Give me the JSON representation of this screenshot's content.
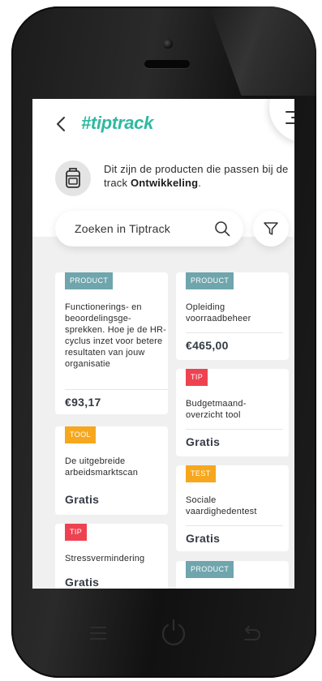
{
  "app": {
    "logo": "#tiptrack",
    "accent_color": "#2fb9a0"
  },
  "header": {
    "back_icon": "chevron-left-icon",
    "menu_icon": "hamburger-menu-icon"
  },
  "intro": {
    "icon": "backpack-icon",
    "text_prefix": "Dit zijn de producten die passen bij de track ",
    "track_name": "Ontwikkeling",
    "text_suffix": "."
  },
  "search": {
    "placeholder": "Zoeken in Tiptrack",
    "icon": "search-icon",
    "filter_icon": "filter-icon"
  },
  "badge_colors": {
    "product": "#6fa5ad",
    "tool": "#f6a71d",
    "test": "#f6a71d",
    "tip": "#ef4251"
  },
  "cards_left": [
    {
      "badge": "PRODUCT",
      "title": "Functionerings- en beoordelingsge-sprekken. Hoe je de HR-cyclus inzet voor betere resultaten van jouw organisatie",
      "price": "€93,17"
    },
    {
      "badge": "TOOL",
      "title": "De uitgebreide arbeidsmarktscan",
      "price": "Gratis"
    },
    {
      "badge": "TIP",
      "title": "Stressvermindering",
      "price": "Gratis"
    }
  ],
  "cards_right": [
    {
      "badge": "PRODUCT",
      "title": "Opleiding voorraadbeheer",
      "price": "€465,00"
    },
    {
      "badge": "TIP",
      "title": "Budgetmaand-overzicht tool",
      "price": "Gratis"
    },
    {
      "badge": "TEST",
      "title": "Sociale vaardighedentest",
      "price": "Gratis"
    },
    {
      "badge": "PRODUCT",
      "title": "",
      "price": ""
    }
  ],
  "device": {
    "nav_buttons": [
      "menu-icon",
      "power-icon",
      "back-icon"
    ]
  }
}
